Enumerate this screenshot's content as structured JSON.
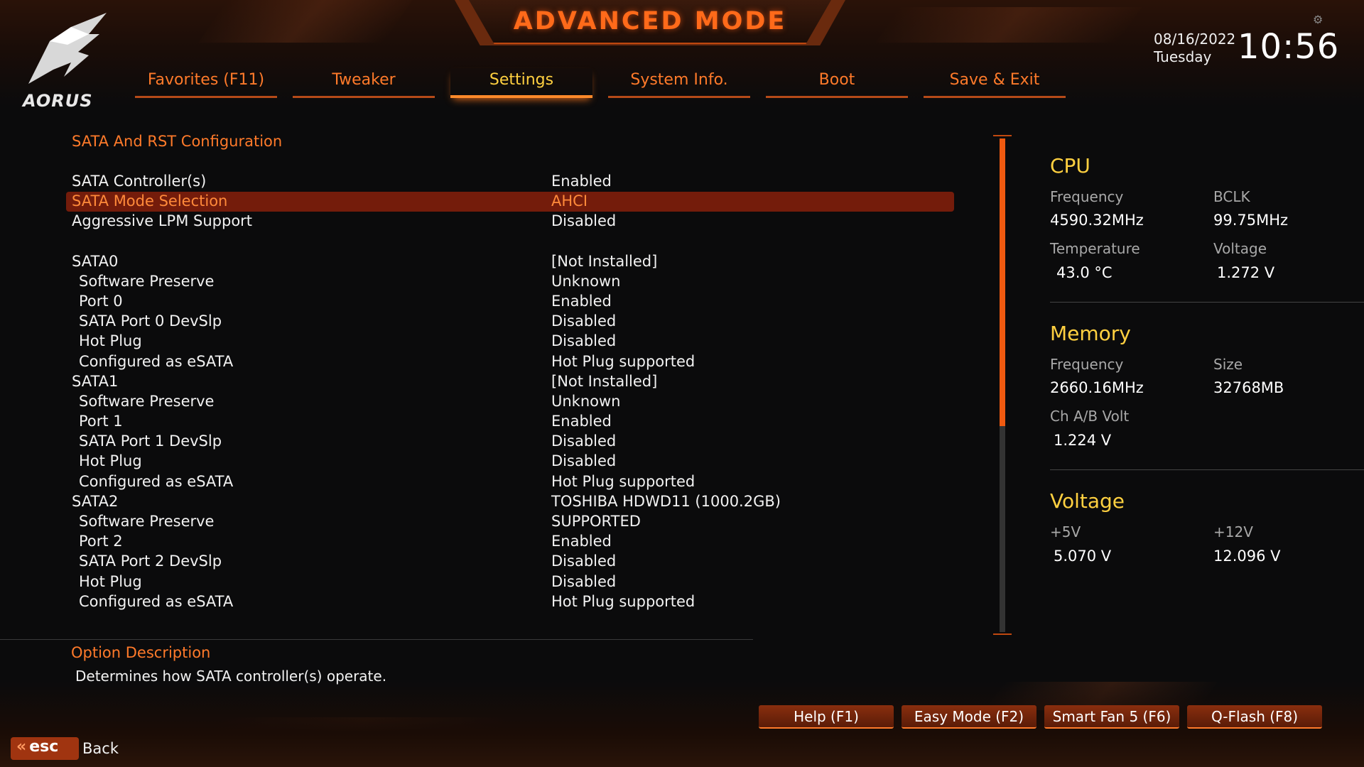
{
  "header": {
    "title": "ADVANCED MODE",
    "logo_text": "AORUS",
    "date": "08/16/2022",
    "day": "Tuesday",
    "time": "10:56"
  },
  "tabs": [
    {
      "label": "Favorites (F11)",
      "active": false
    },
    {
      "label": "Tweaker",
      "active": false
    },
    {
      "label": "Settings",
      "active": true
    },
    {
      "label": "System Info.",
      "active": false
    },
    {
      "label": "Boot",
      "active": false
    },
    {
      "label": "Save & Exit",
      "active": false
    }
  ],
  "section_title": "SATA And RST Configuration",
  "settings": [
    {
      "label": "SATA Controller(s)",
      "value": "Enabled"
    },
    {
      "label": "SATA Mode Selection",
      "value": "AHCI"
    },
    {
      "label": "Aggressive LPM Support",
      "value": "Disabled"
    },
    {
      "label": "SATA0",
      "value": "[Not Installed]"
    },
    {
      "label": "Software Preserve",
      "value": "Unknown"
    },
    {
      "label": "Port 0",
      "value": "Enabled"
    },
    {
      "label": "SATA Port 0 DevSlp",
      "value": "Disabled"
    },
    {
      "label": "Hot Plug",
      "value": "Disabled"
    },
    {
      "label": "Configured as eSATA",
      "value": "Hot Plug supported"
    },
    {
      "label": "SATA1",
      "value": "[Not Installed]"
    },
    {
      "label": "Software Preserve",
      "value": "Unknown"
    },
    {
      "label": "Port 1",
      "value": "Enabled"
    },
    {
      "label": "SATA Port 1 DevSlp",
      "value": "Disabled"
    },
    {
      "label": "Hot Plug",
      "value": "Disabled"
    },
    {
      "label": "Configured as eSATA",
      "value": "Hot Plug supported"
    },
    {
      "label": "SATA2",
      "value": "TOSHIBA HDWD11 (1000.2GB)"
    },
    {
      "label": "Software Preserve",
      "value": "SUPPORTED"
    },
    {
      "label": "Port 2",
      "value": "Enabled"
    },
    {
      "label": "SATA Port 2 DevSlp",
      "value": "Disabled"
    },
    {
      "label": "Hot Plug",
      "value": "Disabled"
    },
    {
      "label": "Configured as eSATA",
      "value": "Hot Plug supported"
    }
  ],
  "info": {
    "cpu": {
      "heading": "CPU",
      "frequency_label": "Frequency",
      "frequency": "4590.32MHz",
      "bclk_label": "BCLK",
      "bclk": "99.75MHz",
      "temperature_label": "Temperature",
      "temperature": "43.0 °C",
      "voltage_label": "Voltage",
      "voltage": "1.272 V"
    },
    "memory": {
      "heading": "Memory",
      "frequency_label": "Frequency",
      "frequency": "2660.16MHz",
      "size_label": "Size",
      "size": "32768MB",
      "volt_label": "Ch A/B Volt",
      "volt": "1.224 V"
    },
    "voltage": {
      "heading": "Voltage",
      "p5_label": "+5V",
      "p5": "5.070 V",
      "p12_label": "+12V",
      "p12": "12.096 V"
    }
  },
  "description": {
    "title": "Option Description",
    "text": "Determines how SATA controller(s) operate."
  },
  "footer": {
    "buttons": [
      "Help (F1)",
      "Easy Mode (F2)",
      "Smart Fan 5 (F6)",
      "Q-Flash (F8)"
    ],
    "esc_label": "esc",
    "back_label": "Back"
  },
  "colors": {
    "accent": "#ff7a2a",
    "highlight": "#ffd040",
    "selected_row": "#741c0b"
  }
}
